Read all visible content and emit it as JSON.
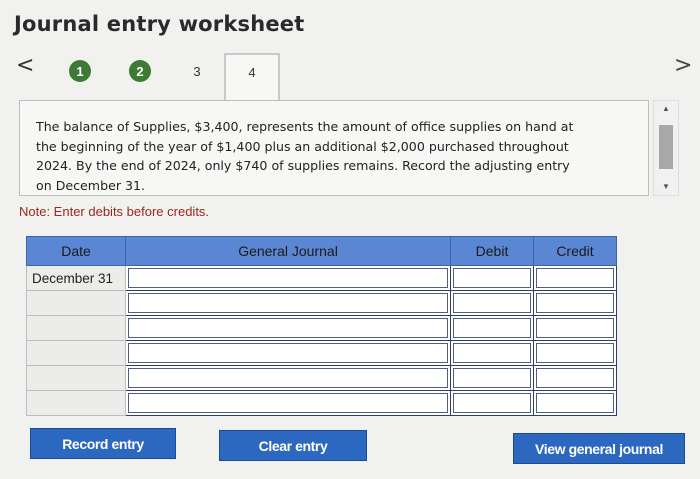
{
  "header": {
    "title": "Journal entry worksheet"
  },
  "nav": {
    "prev_glyph": "<",
    "next_glyph": ">"
  },
  "steps": [
    {
      "label": "1",
      "status": "completed"
    },
    {
      "label": "2",
      "status": "completed"
    },
    {
      "label": "3",
      "status": "incomplete"
    },
    {
      "label": "4",
      "status": "current"
    }
  ],
  "prompt": {
    "text": "The balance of Supplies, $3,400, represents the amount of office supplies on hand at the beginning of the year of $1,400 plus an additional $2,000 purchased throughout 2024. By the end of 2024, only $740 of supplies remains. Record the adjusting entry on December 31."
  },
  "note": "Note: Enter debits before credits.",
  "table": {
    "headers": {
      "date": "Date",
      "journal": "General Journal",
      "debit": "Debit",
      "credit": "Credit"
    },
    "rows": [
      {
        "date": "December 31"
      },
      {
        "date": ""
      },
      {
        "date": ""
      },
      {
        "date": ""
      },
      {
        "date": ""
      },
      {
        "date": ""
      }
    ]
  },
  "buttons": {
    "record": "Record entry",
    "clear": "Clear entry",
    "view": "View general journal"
  },
  "colors": {
    "step_complete": "#3d7a33",
    "header_blue": "#5b86d4",
    "button_blue": "#2c67c0",
    "note_red": "#9a2a1a"
  }
}
